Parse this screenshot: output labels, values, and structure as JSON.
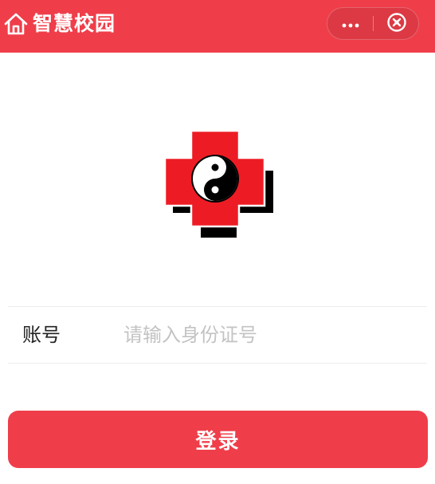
{
  "header": {
    "title": "智慧校园",
    "background_color": "#ef3e4a",
    "home_icon": "home-icon",
    "capsule": {
      "more_icon": "more-dots-icon",
      "close_icon": "close-circle-icon"
    }
  },
  "logo": {
    "icon": "red-cross-yin-yang-logo",
    "cross_color": "#ed1c24"
  },
  "form": {
    "account_label": "账号",
    "account_value": "",
    "account_placeholder": "请输入身份证号"
  },
  "login_button": {
    "label": "登录",
    "color": "#ef3e4a"
  }
}
